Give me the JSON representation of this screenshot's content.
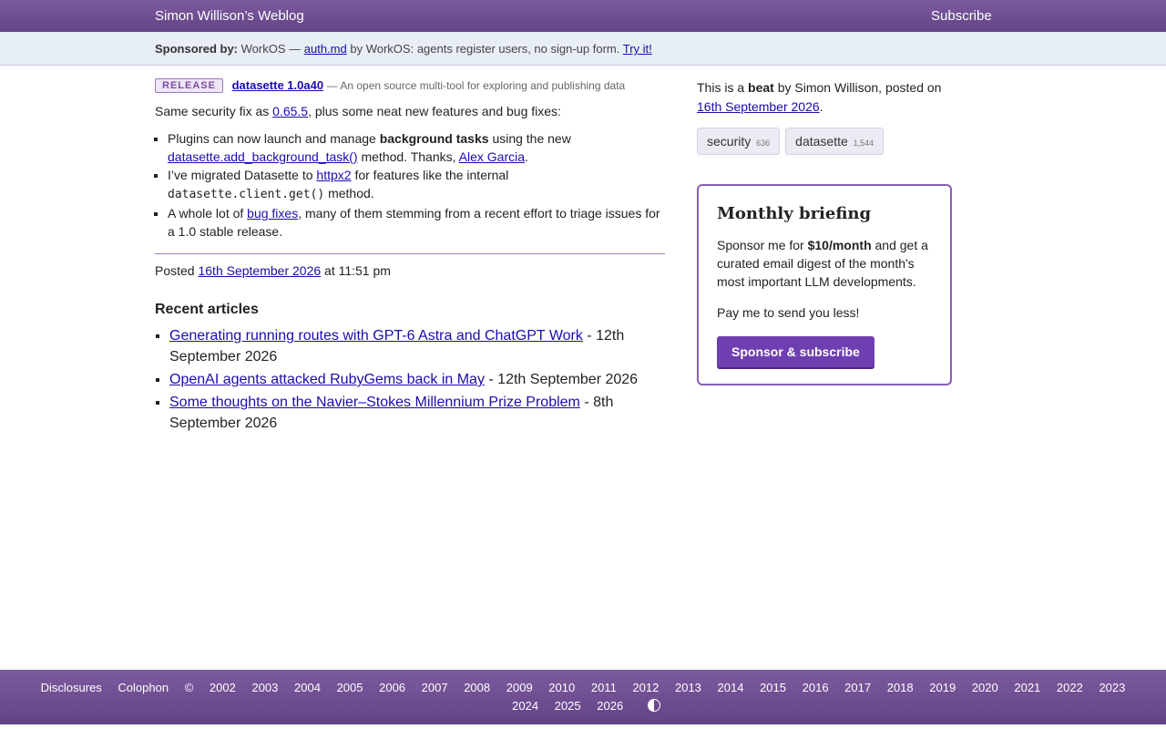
{
  "header": {
    "site_title": "Simon Willison’s Weblog",
    "subscribe_label": "Subscribe"
  },
  "sponsor": {
    "label": "Sponsored by:",
    "sponsor_name": "WorkOS —",
    "link_text": "auth.md",
    "tagline": "by WorkOS: agents register users, no sign-up form.",
    "cta": "Try it!"
  },
  "post": {
    "badge": "RELEASE",
    "title": "datasette 1.0a40",
    "description": "— An open source multi-tool for exploring and publishing data",
    "intro_before": "Same security fix as",
    "intro_link": "0.65.5",
    "intro_after": ", plus some neat new features and bug fixes:",
    "bullet1_before": "Plugins can now launch and manage",
    "bullet1_bold": "background tasks",
    "bullet1_mid": "using the new",
    "bullet1_link": "datasette.add_background_task()",
    "bullet1_mid2": "method. Thanks,",
    "bullet1_author": "Alex Garcia",
    "bullet1_end": ".",
    "bullet2_before": "I’ve migrated Datasette to",
    "bullet2_link": "httpx2",
    "bullet2_mid": "for features like the internal",
    "bullet2_code": "datasette.client.get()",
    "bullet2_end": "method.",
    "bullet3_before": "A whole lot of",
    "bullet3_link": "bug fixes",
    "bullet3_after": ", many of them stemming from a recent effort to triage issues for a 1.0 stable release.",
    "posted_label": "Posted",
    "posted_date": "16th September 2026",
    "posted_time": "at 11:51 pm"
  },
  "recent": {
    "heading": "Recent articles",
    "items": [
      {
        "title": "Generating running routes with GPT-6 Astra and ChatGPT Work",
        "date": "- 12th September 2026"
      },
      {
        "title": "OpenAI agents attacked RubyGems back in May",
        "date": "- 12th September 2026"
      },
      {
        "title": "Some thoughts on the Navier–Stokes Millennium Prize Problem",
        "date": "- 8th September 2026"
      }
    ]
  },
  "sidebar": {
    "beat_prefix": "This is a",
    "beat_word": "beat",
    "beat_suffix": "by Simon Willison, posted on",
    "beat_date": "16th September 2026",
    "beat_end": ".",
    "tags": [
      {
        "name": "security",
        "count": "636"
      },
      {
        "name": "datasette",
        "count": "1,544"
      }
    ],
    "briefing": {
      "heading": "Monthly briefing",
      "body_before": "Sponsor me for",
      "body_price": "$10/month",
      "body_after": "and get a curated email digest of the month's most important LLM developments.",
      "less": "Pay me to send you less!",
      "button": "Sponsor & subscribe"
    }
  },
  "footer": {
    "links": [
      "Disclosures",
      "Colophon",
      "©",
      "2002",
      "2003",
      "2004",
      "2005",
      "2006",
      "2007",
      "2008",
      "2009",
      "2010",
      "2011",
      "2012",
      "2013",
      "2014",
      "2015",
      "2016",
      "2017",
      "2018",
      "2019",
      "2020",
      "2021",
      "2022",
      "2023"
    ],
    "links_row2": [
      "2024",
      "2025",
      "2026"
    ],
    "contrast_icon": "contrast-toggle-icon"
  },
  "colors": {
    "brand": "#6e3fb0",
    "header_bg": "#7c5a9e",
    "sponsor_bg": "#e8eef6",
    "link": "#1a0dab"
  }
}
